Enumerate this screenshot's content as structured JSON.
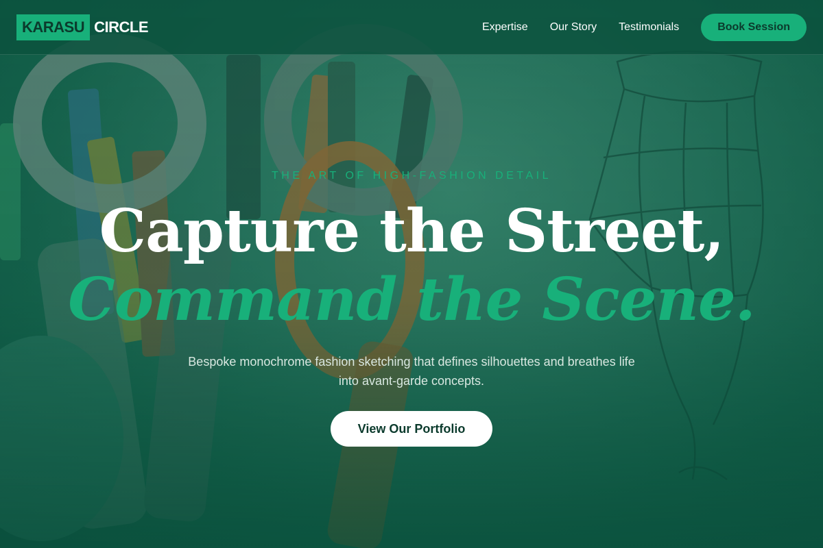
{
  "brand": {
    "logo_box": "KARASU",
    "logo_text": "CIRCLE",
    "accent_color": "#18b07a",
    "background_color": "#0f5a44"
  },
  "nav": {
    "links": [
      "Expertise",
      "Our Story",
      "Testimonials"
    ],
    "cta_label": "Book Session"
  },
  "hero": {
    "eyebrow": "THE ART OF HIGH-FASHION DETAIL",
    "headline_line1": "Capture the Street,",
    "headline_line2": "Command the Scene.",
    "description": "Bespoke monochrome fashion sketching that defines silhouettes and breathes life into avant-garde concepts.",
    "button_label": "View Our Portfolio",
    "background_image": "scissors-and-pencils-with-dress-sketch"
  }
}
